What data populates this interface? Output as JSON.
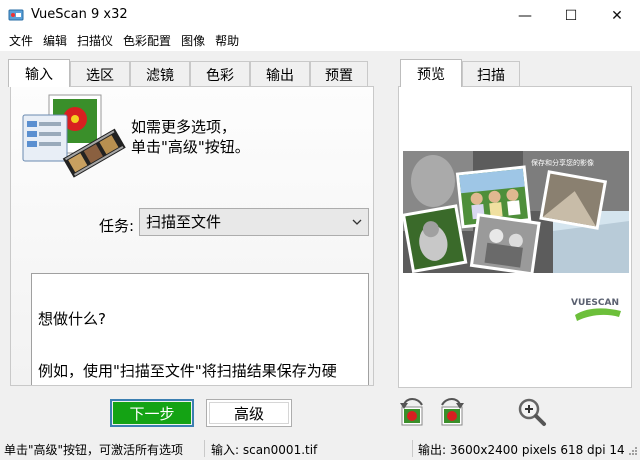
{
  "window": {
    "title": "VueScan 9 x32",
    "controls": {
      "minimize": "—",
      "maximize": "☐",
      "close": "✕"
    }
  },
  "menu": [
    "文件",
    "编辑",
    "扫描仪",
    "色彩配置",
    "图像",
    "帮助"
  ],
  "left_tabs": [
    "输入",
    "选区",
    "滤镜",
    "色彩",
    "输出",
    "预置"
  ],
  "left_active_tab": "输入",
  "tip": {
    "line1": "如需更多选项，",
    "line2": "单击\"高级\"按钮。"
  },
  "task": {
    "label": "任务:",
    "value": "扫描至文件"
  },
  "description": {
    "question": "想做什么?",
    "example": "例如，使用\"扫描至文件\"将扫描结果保存为硬"
  },
  "right_tabs": [
    "预览",
    "扫描"
  ],
  "right_active_tab": "预览",
  "preview": {
    "banner_text": "保存和分享您的影像",
    "logo_text": "VUESCAN"
  },
  "buttons": {
    "next": "下一步",
    "advanced": "高级"
  },
  "toolbar_icons": [
    "rotate-left-icon",
    "rotate-right-icon",
    "zoom-in-icon"
  ],
  "status": {
    "hint": "单击\"高级\"按钮，可激活所有选项",
    "input": "输入: scan0001.tif",
    "output": "输出: 3600x2400 pixels 618 dpi 14..."
  },
  "colors": {
    "next_green": "#14a314",
    "focus_blue": "#3c7fb1",
    "panel_border": "#c9c9c9"
  }
}
